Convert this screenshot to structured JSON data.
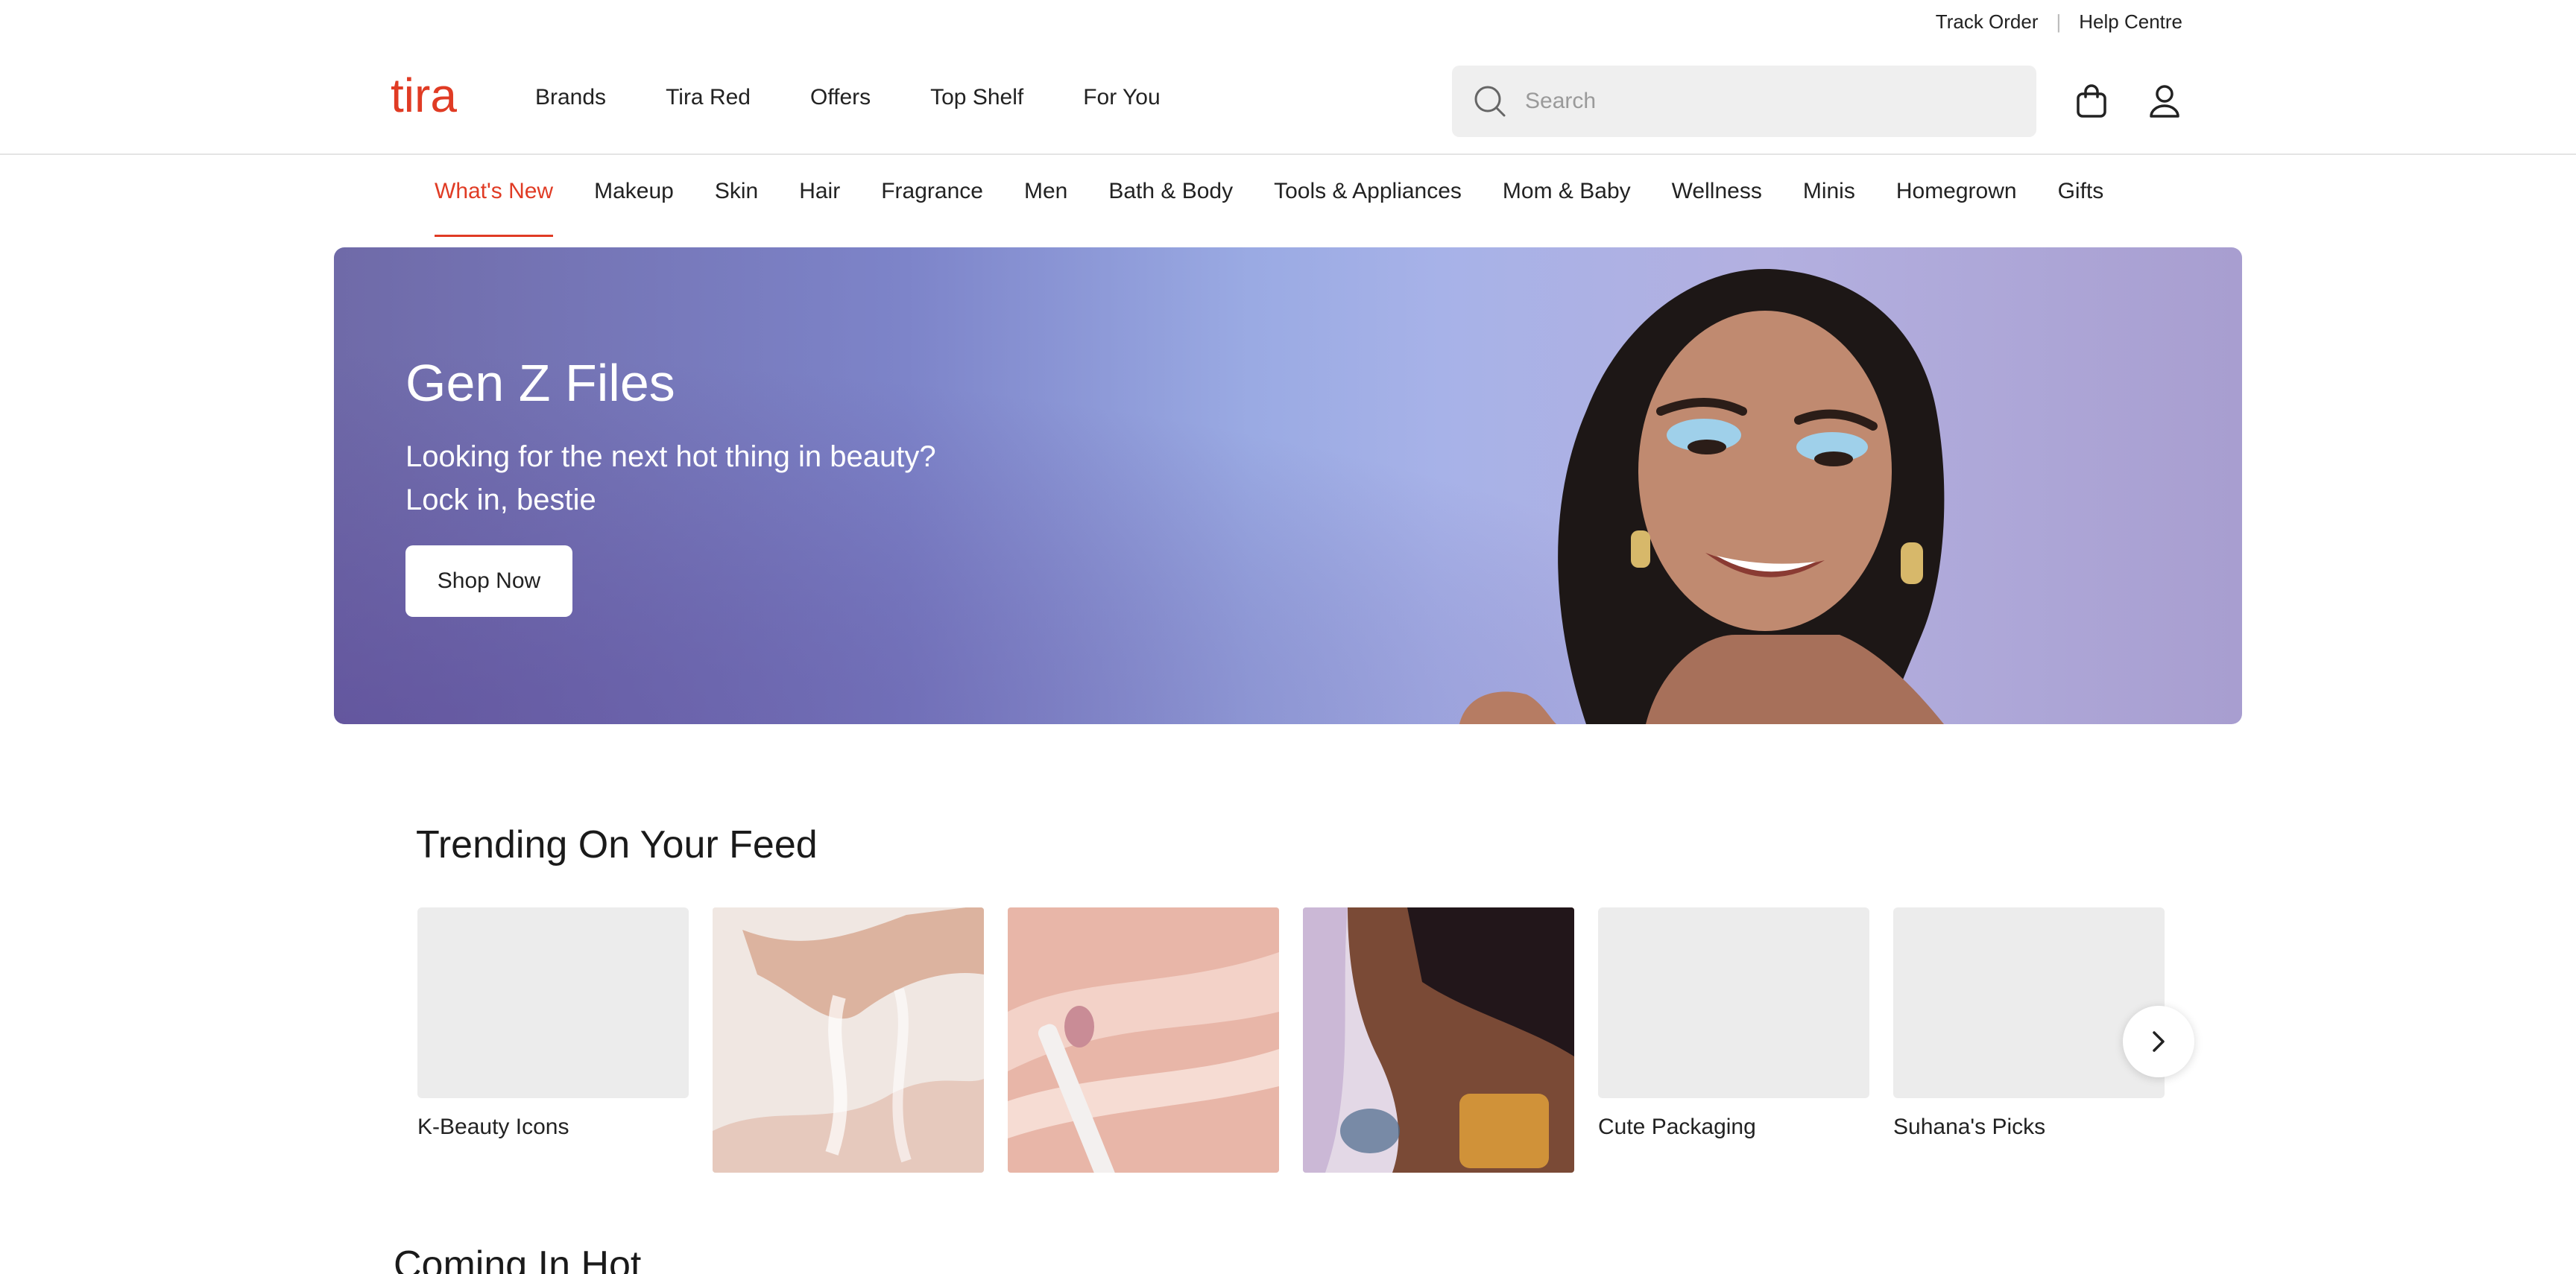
{
  "utility": {
    "track_order": "Track Order",
    "help_centre": "Help Centre"
  },
  "header": {
    "logo_text": "tira",
    "nav": [
      "Brands",
      "Tira Red",
      "Offers",
      "Top Shelf",
      "For You"
    ],
    "search_placeholder": "Search",
    "brand_color": "#e03b24"
  },
  "categories": {
    "active_index": 0,
    "items": [
      "What's New",
      "Makeup",
      "Skin",
      "Hair",
      "Fragrance",
      "Men",
      "Bath & Body",
      "Tools & Appliances",
      "Mom & Baby",
      "Wellness",
      "Minis",
      "Homegrown",
      "Gifts"
    ]
  },
  "hero": {
    "title": "Gen Z Files",
    "subtitle_line1": "Looking for the next hot thing in beauty?",
    "subtitle_line2": "Lock in, bestie",
    "button": "Shop Now"
  },
  "trending": {
    "title": "Trending On Your Feed",
    "cards": [
      {
        "label": "K-Beauty Icons",
        "image": "placeholder"
      },
      {
        "label": "",
        "image": "clear-gel-stretch"
      },
      {
        "label": "",
        "image": "pink-lip-gloss-swatch"
      },
      {
        "label": "",
        "image": "woman-with-perfume"
      },
      {
        "label": "Cute Packaging",
        "image": "placeholder"
      },
      {
        "label": "Suhana's Picks",
        "image": "placeholder"
      }
    ]
  },
  "coming": {
    "title": "Coming In Hot"
  }
}
